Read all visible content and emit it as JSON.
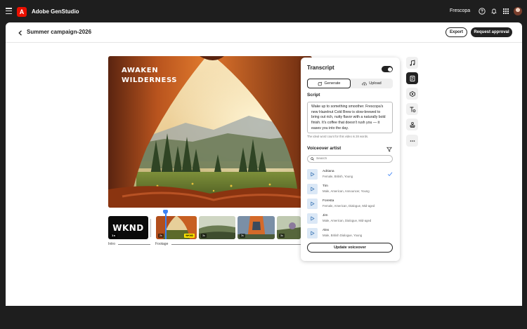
{
  "app": {
    "name": "Adobe GenStudio",
    "logo_letter": "A",
    "org": "Frescopa"
  },
  "header": {
    "title": "Summer campaign-2026",
    "export_label": "Export",
    "approval_label": "Request approval"
  },
  "preview": {
    "overlay_line1": "AWAKEN",
    "overlay_line2": "WILDERNESS"
  },
  "timeline": {
    "logo_text": "WKND",
    "clips": [
      {
        "duration": "1s"
      },
      {
        "duration": "2s",
        "badge": "WKND"
      },
      {
        "duration": "3s"
      },
      {
        "duration": "3s"
      },
      {
        "duration": "3s"
      }
    ],
    "labels": {
      "intro": "Intro",
      "footage": "Footage"
    }
  },
  "panel": {
    "title": "Transcript",
    "toggle_on": true,
    "generate_label": "Generate",
    "upload_label": "Upload",
    "script_label": "Script",
    "script_text": "Wake up to something smoother. Frescopa's new Hazelnut Cold Brew is slow-brewed to bring out rich, nutty flavor with a naturally bold finish. It's coffee that doesn't rush you — it eases you into the day.",
    "helper_text": "The ideal word count for this video is 28 words.",
    "voiceover_label": "Voiceover artist",
    "search_placeholder": "Search",
    "artists": [
      {
        "name": "Adriana",
        "meta": "Female, British, Young",
        "selected": true
      },
      {
        "name": "Tim",
        "meta": "Male, American, Announcer, Young",
        "selected": false
      },
      {
        "name": "Foresta",
        "meta": "Female, American, Dialogue, Mid-aged",
        "selected": false
      },
      {
        "name": "Jim",
        "meta": "Male, American, Dialogue, Mid-aged",
        "selected": false
      },
      {
        "name": "Alex",
        "meta": "Male, British Dialogue, Young",
        "selected": false
      }
    ],
    "update_label": "Update voiceover"
  },
  "tools": [
    "music-icon",
    "transcript-icon",
    "brand-icon",
    "text-icon",
    "stamp-icon",
    "more-icon"
  ],
  "colors": {
    "accent": "#3b82f6",
    "brand": "#eb1000",
    "dark": "#222222"
  }
}
